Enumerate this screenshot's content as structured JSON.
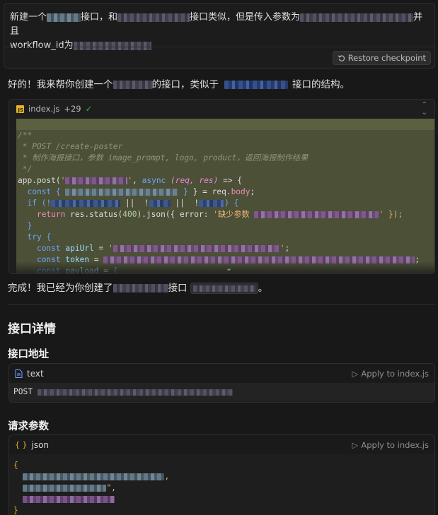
{
  "user_message": {
    "part1": "新建一个",
    "part2": "接口，和",
    "part3": "接口类似，但是传入参数为",
    "part4": "并且",
    "part5": "workflow_id为",
    "restore_label": "Restore checkpoint"
  },
  "reply_intro": {
    "part1": "好的！我来帮你创建一个",
    "part2": "的接口，类似于",
    "part3": "接口的结构。"
  },
  "file_card": {
    "file_name": "index.js",
    "additions": "+29",
    "check": "✓",
    "code": {
      "comment_open": "/**",
      "comment_route": " * POST /create-poster",
      "comment_desc": " * 制作海报接口，参数 image_prompt, logo, product，返回海报制作结果",
      "comment_close": " */",
      "app_post": "app.post(",
      "async": "async",
      "params": "(req, res)",
      "arrow": " => {",
      "const": "const",
      "req_body": "} = req.",
      "body": "body",
      "if_kw": "if",
      "or_ops": "||  !",
      "return_kw": "return",
      "res_status": "res.status(",
      "status_code": "400",
      "json_call": ").json({ error: ",
      "error_msg": "'缺少参数",
      "close_call": "' });",
      "close_brace": "}",
      "try_kw": "try",
      "api_url": "apiUrl",
      "token": "token",
      "payload": "payload"
    }
  },
  "completion": {
    "part1": "完成！我已经为你创建了",
    "part2": "接口",
    "part3": "。"
  },
  "section_title": "接口详情",
  "endpoint": {
    "title": "接口地址",
    "lang": "text",
    "apply_label": "Apply to index.js",
    "method": "POST"
  },
  "request": {
    "title": "请求参数",
    "lang": "json",
    "apply_label": "Apply to index.js",
    "open": "{",
    "close": "}"
  }
}
